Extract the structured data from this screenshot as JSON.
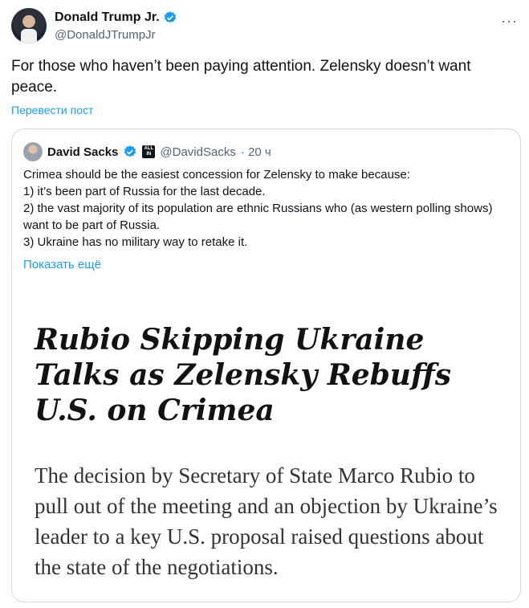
{
  "author": {
    "name": "Donald Trump Jr.",
    "handle": "@DonaldJTrumpJr",
    "verified_icon": "verified-badge-icon"
  },
  "menu_icon": "···",
  "tweet": {
    "text": "For those who haven’t been paying attention. Zelensky doesn’t want peace.",
    "translate_label": "Перевести пост"
  },
  "quote": {
    "name": "David Sacks",
    "badge": "ALL IN",
    "handle": "@DavidSacks",
    "time": "· 20 ч",
    "lines": [
      "Crimea should be the easiest concession for Zelensky to make because:",
      "1) it’s been part of Russia for the last decade.",
      "2) the vast majority of its population are ethnic Russians who (as western polling shows) want to be part of Russia.",
      "3) Ukraine has no military way to retake it."
    ],
    "show_more": "Показать ещё",
    "image": {
      "headline": "Rubio Skipping Ukraine Talks as Zelensky Rebuffs U.S. on Crimea",
      "summary": "The decision by Secretary of State Marco Rubio to pull out of the meeting and an objection by Ukraine’s leader to a key U.S. proposal raised questions about the state of the negotiations."
    }
  },
  "colors": {
    "accent": "#1d9bf0",
    "muted": "#536471",
    "border": "#cfd9de"
  }
}
